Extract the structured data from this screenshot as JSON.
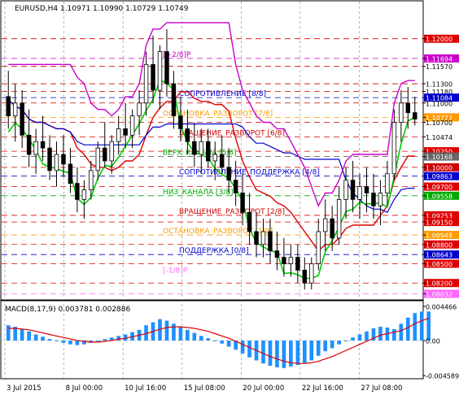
{
  "chart_data": [
    {
      "type": "candlestick",
      "symbol_line": "EURUSD,H4  1.10971 1.10990 1.10729 1.10749",
      "ylim": [
        1.0795,
        1.1235
      ],
      "x_ticks": [
        "3 Jul 2015",
        "8 Jul 00:00",
        "10 Jul 16:00",
        "15 Jul 08:00",
        "20 Jul 00:00",
        "22 Jul 16:00",
        "27 Jul 08:00"
      ],
      "price_ticks": [
        "1.12000",
        "1.11694",
        "1.11570",
        "1.11300",
        "1.11180",
        "1.11084",
        "1.11000",
        "1.10777",
        "1.10700",
        "1.10474",
        "1.10250",
        "1.10168",
        "1.10000",
        "1.09863",
        "1.09700",
        "1.09558",
        "1.09253",
        "1.09150",
        "1.08948",
        "1.08800",
        "1.08643",
        "1.08500",
        "1.08200",
        "1.08032"
      ],
      "highlighted_ticks": [
        {
          "label": "1.12000",
          "color": "#dd0000"
        },
        {
          "label": "1.11694",
          "color": "#cc00cc"
        },
        {
          "label": "1.11084",
          "color": "#0000cc"
        },
        {
          "label": "1.10777",
          "color": "#ff9900"
        },
        {
          "label": "1.10250",
          "color": "#dd0000"
        },
        {
          "label": "1.10168",
          "color": "#666666"
        },
        {
          "label": "1.10000",
          "color": "#cc0000"
        },
        {
          "label": "1.09863",
          "color": "#0000cc"
        },
        {
          "label": "1.09700",
          "color": "#dd0000"
        },
        {
          "label": "1.09558",
          "color": "#00aa00"
        },
        {
          "label": "1.09253",
          "color": "#dd0000"
        },
        {
          "label": "1.09150",
          "color": "#dd0000"
        },
        {
          "label": "1.08948",
          "color": "#ff9900"
        },
        {
          "label": "1.08800",
          "color": "#dd0000"
        },
        {
          "label": "1.08643",
          "color": "#0000cc"
        },
        {
          "label": "1.08500",
          "color": "#dd0000"
        },
        {
          "label": "1.08200",
          "color": "#dd0000"
        },
        {
          "label": "1.08032",
          "color": "#ff66ff"
        }
      ],
      "murrey_levels": [
        {
          "label": "[+2/8]P",
          "price": 1.11694,
          "color": "#cc00cc"
        },
        {
          "label": "СОПРОТИВЛЕНИЕ [8/8]",
          "price": 1.11084,
          "color": "#0000cc"
        },
        {
          "label": "ОСТАНОВКА_РАЗВОРОТ [7/8]",
          "price": 1.10777,
          "color": "#ff9900"
        },
        {
          "label": "ВРАЩЕНИЕ_РАЗВОРОТ [6/8]",
          "price": 1.10474,
          "color": "#cc0000"
        },
        {
          "label": "ВЕРХ_КАНАЛА [5/8]",
          "price": 1.10168,
          "color": "#00aa00"
        },
        {
          "label": "СОПРОТИВЛЕНИЕ_ПОДДЕРЖКА [4/8]",
          "price": 1.09863,
          "color": "#0000cc"
        },
        {
          "label": "НИЗ_КАНАЛА [3/8]",
          "price": 1.09558,
          "color": "#00aa00"
        },
        {
          "label": "ВРАЩЕНИЕ_РАЗВОРОТ [2/8]",
          "price": 1.09253,
          "color": "#cc0000"
        },
        {
          "label": "ОСТАНОВКА_РАЗВОРОТ [1/8]",
          "price": 1.08948,
          "color": "#ff9900"
        },
        {
          "label": "ПОДДЕРЖКА [0/8]",
          "price": 1.08643,
          "color": "#0000cc"
        },
        {
          "label": "[-1/8]P",
          "price": 1.08338,
          "color": "#ff66ff"
        }
      ],
      "candles": [
        {
          "o": 1.111,
          "h": 1.115,
          "l": 1.106,
          "c": 1.108
        },
        {
          "o": 1.108,
          "h": 1.113,
          "l": 1.104,
          "c": 1.11
        },
        {
          "o": 1.11,
          "h": 1.112,
          "l": 1.103,
          "c": 1.105
        },
        {
          "o": 1.105,
          "h": 1.109,
          "l": 1.1,
          "c": 1.102
        },
        {
          "o": 1.102,
          "h": 1.106,
          "l": 1.099,
          "c": 1.104
        },
        {
          "o": 1.104,
          "h": 1.108,
          "l": 1.101,
          "c": 1.103
        },
        {
          "o": 1.103,
          "h": 1.105,
          "l": 1.098,
          "c": 1.0995
        },
        {
          "o": 1.0995,
          "h": 1.104,
          "l": 1.097,
          "c": 1.102
        },
        {
          "o": 1.102,
          "h": 1.105,
          "l": 1.0985,
          "c": 1.1005
        },
        {
          "o": 1.1005,
          "h": 1.103,
          "l": 1.096,
          "c": 1.0975
        },
        {
          "o": 1.0975,
          "h": 1.1,
          "l": 1.093,
          "c": 1.095
        },
        {
          "o": 1.095,
          "h": 1.098,
          "l": 1.092,
          "c": 1.0965
        },
        {
          "o": 1.0965,
          "h": 1.101,
          "l": 1.095,
          "c": 1.0995
        },
        {
          "o": 1.0995,
          "h": 1.104,
          "l": 1.098,
          "c": 1.103
        },
        {
          "o": 1.103,
          "h": 1.107,
          "l": 1.1,
          "c": 1.101
        },
        {
          "o": 1.101,
          "h": 1.105,
          "l": 1.099,
          "c": 1.104
        },
        {
          "o": 1.104,
          "h": 1.108,
          "l": 1.102,
          "c": 1.106
        },
        {
          "o": 1.106,
          "h": 1.11,
          "l": 1.103,
          "c": 1.105
        },
        {
          "o": 1.105,
          "h": 1.109,
          "l": 1.103,
          "c": 1.108
        },
        {
          "o": 1.108,
          "h": 1.112,
          "l": 1.105,
          "c": 1.11
        },
        {
          "o": 1.11,
          "h": 1.118,
          "l": 1.108,
          "c": 1.116
        },
        {
          "o": 1.116,
          "h": 1.1205,
          "l": 1.11,
          "c": 1.112
        },
        {
          "o": 1.112,
          "h": 1.119,
          "l": 1.109,
          "c": 1.118
        },
        {
          "o": 1.118,
          "h": 1.1215,
          "l": 1.111,
          "c": 1.113
        },
        {
          "o": 1.113,
          "h": 1.115,
          "l": 1.106,
          "c": 1.108
        },
        {
          "o": 1.108,
          "h": 1.111,
          "l": 1.104,
          "c": 1.106
        },
        {
          "o": 1.106,
          "h": 1.109,
          "l": 1.102,
          "c": 1.104
        },
        {
          "o": 1.104,
          "h": 1.107,
          "l": 1.1,
          "c": 1.102
        },
        {
          "o": 1.102,
          "h": 1.106,
          "l": 1.099,
          "c": 1.104
        },
        {
          "o": 1.104,
          "h": 1.106,
          "l": 1.1,
          "c": 1.101
        },
        {
          "o": 1.101,
          "h": 1.104,
          "l": 1.098,
          "c": 1.102
        },
        {
          "o": 1.102,
          "h": 1.105,
          "l": 1.099,
          "c": 1.1
        },
        {
          "o": 1.1,
          "h": 1.103,
          "l": 1.096,
          "c": 1.098
        },
        {
          "o": 1.098,
          "h": 1.101,
          "l": 1.094,
          "c": 1.096
        },
        {
          "o": 1.096,
          "h": 1.099,
          "l": 1.091,
          "c": 1.093
        },
        {
          "o": 1.093,
          "h": 1.096,
          "l": 1.088,
          "c": 1.09
        },
        {
          "o": 1.09,
          "h": 1.093,
          "l": 1.086,
          "c": 1.088
        },
        {
          "o": 1.088,
          "h": 1.092,
          "l": 1.086,
          "c": 1.09
        },
        {
          "o": 1.09,
          "h": 1.092,
          "l": 1.085,
          "c": 1.087
        },
        {
          "o": 1.087,
          "h": 1.09,
          "l": 1.084,
          "c": 1.086
        },
        {
          "o": 1.086,
          "h": 1.089,
          "l": 1.083,
          "c": 1.085
        },
        {
          "o": 1.085,
          "h": 1.088,
          "l": 1.083,
          "c": 1.086
        },
        {
          "o": 1.086,
          "h": 1.088,
          "l": 1.082,
          "c": 1.084
        },
        {
          "o": 1.084,
          "h": 1.086,
          "l": 1.081,
          "c": 1.082
        },
        {
          "o": 1.082,
          "h": 1.086,
          "l": 1.081,
          "c": 1.085
        },
        {
          "o": 1.085,
          "h": 1.092,
          "l": 1.084,
          "c": 1.09
        },
        {
          "o": 1.09,
          "h": 1.095,
          "l": 1.087,
          "c": 1.092
        },
        {
          "o": 1.092,
          "h": 1.094,
          "l": 1.087,
          "c": 1.089
        },
        {
          "o": 1.089,
          "h": 1.097,
          "l": 1.088,
          "c": 1.095
        },
        {
          "o": 1.095,
          "h": 1.1,
          "l": 1.092,
          "c": 1.098
        },
        {
          "o": 1.098,
          "h": 1.101,
          "l": 1.093,
          "c": 1.095
        },
        {
          "o": 1.095,
          "h": 1.099,
          "l": 1.092,
          "c": 1.097
        },
        {
          "o": 1.097,
          "h": 1.1,
          "l": 1.093,
          "c": 1.096
        },
        {
          "o": 1.096,
          "h": 1.099,
          "l": 1.092,
          "c": 1.094
        },
        {
          "o": 1.094,
          "h": 1.098,
          "l": 1.091,
          "c": 1.096
        },
        {
          "o": 1.096,
          "h": 1.101,
          "l": 1.094,
          "c": 1.099
        },
        {
          "o": 1.099,
          "h": 1.109,
          "l": 1.098,
          "c": 1.107
        },
        {
          "o": 1.107,
          "h": 1.112,
          "l": 1.104,
          "c": 1.11
        },
        {
          "o": 1.11,
          "h": 1.1125,
          "l": 1.106,
          "c": 1.1085
        },
        {
          "o": 1.1085,
          "h": 1.111,
          "l": 1.1065,
          "c": 1.1075
        }
      ]
    },
    {
      "type": "bar+line",
      "title": "MACD(8,17,9) 0.003781 0.002886",
      "ylim": [
        -0.005,
        0.005
      ],
      "y_ticks": [
        "0.004466",
        "0.00",
        "-0.004589"
      ],
      "histogram": [
        0.002,
        0.0018,
        0.0015,
        0.0012,
        0.0008,
        0.0005,
        0.0002,
        -0.0001,
        -0.0003,
        -0.0005,
        -0.0006,
        -0.0005,
        -0.0003,
        -0.0001,
        0.0002,
        0.0004,
        0.0006,
        0.0008,
        0.0011,
        0.0014,
        0.002,
        0.0024,
        0.0028,
        0.0026,
        0.0022,
        0.0018,
        0.0014,
        0.001,
        0.0006,
        0.0003,
        -0.0001,
        -0.0004,
        -0.0008,
        -0.0012,
        -0.0017,
        -0.0022,
        -0.0026,
        -0.003,
        -0.0033,
        -0.0035,
        -0.0036,
        -0.0034,
        -0.0032,
        -0.003,
        -0.0026,
        -0.002,
        -0.0014,
        -0.001,
        -0.0005,
        0.0,
        0.0004,
        0.0008,
        0.0012,
        0.0016,
        0.0018,
        0.0017,
        0.0015,
        0.0022,
        0.003,
        0.0036,
        0.0038,
        0.0038
      ],
      "signal": [
        0.0016,
        0.0016,
        0.0015,
        0.0014,
        0.0012,
        0.001,
        0.0008,
        0.0006,
        0.0004,
        0.0002,
        0.0,
        -0.0001,
        -0.0002,
        -0.0002,
        -0.0001,
        0.0,
        0.0002,
        0.0003,
        0.0005,
        0.0007,
        0.0009,
        0.0012,
        0.0015,
        0.0017,
        0.0018,
        0.0018,
        0.0017,
        0.0016,
        0.0014,
        0.0012,
        0.0009,
        0.0006,
        0.0003,
        -0.0001,
        -0.0005,
        -0.0009,
        -0.0013,
        -0.0017,
        -0.0021,
        -0.0024,
        -0.0027,
        -0.0029,
        -0.003,
        -0.003,
        -0.0029,
        -0.0027,
        -0.0024,
        -0.0021,
        -0.0017,
        -0.0013,
        -0.0009,
        -0.0005,
        -0.0001,
        0.0003,
        0.0007,
        0.0009,
        0.0011,
        0.0013,
        0.0017,
        0.0022,
        0.0026,
        0.0029
      ]
    }
  ],
  "colors": {
    "up_body": "#ffffff",
    "down_body": "#000000",
    "grid": "#888888",
    "macd_bars": "#1e90ff",
    "macd_signal": "#dd0000",
    "current_price": "#0000cc"
  }
}
